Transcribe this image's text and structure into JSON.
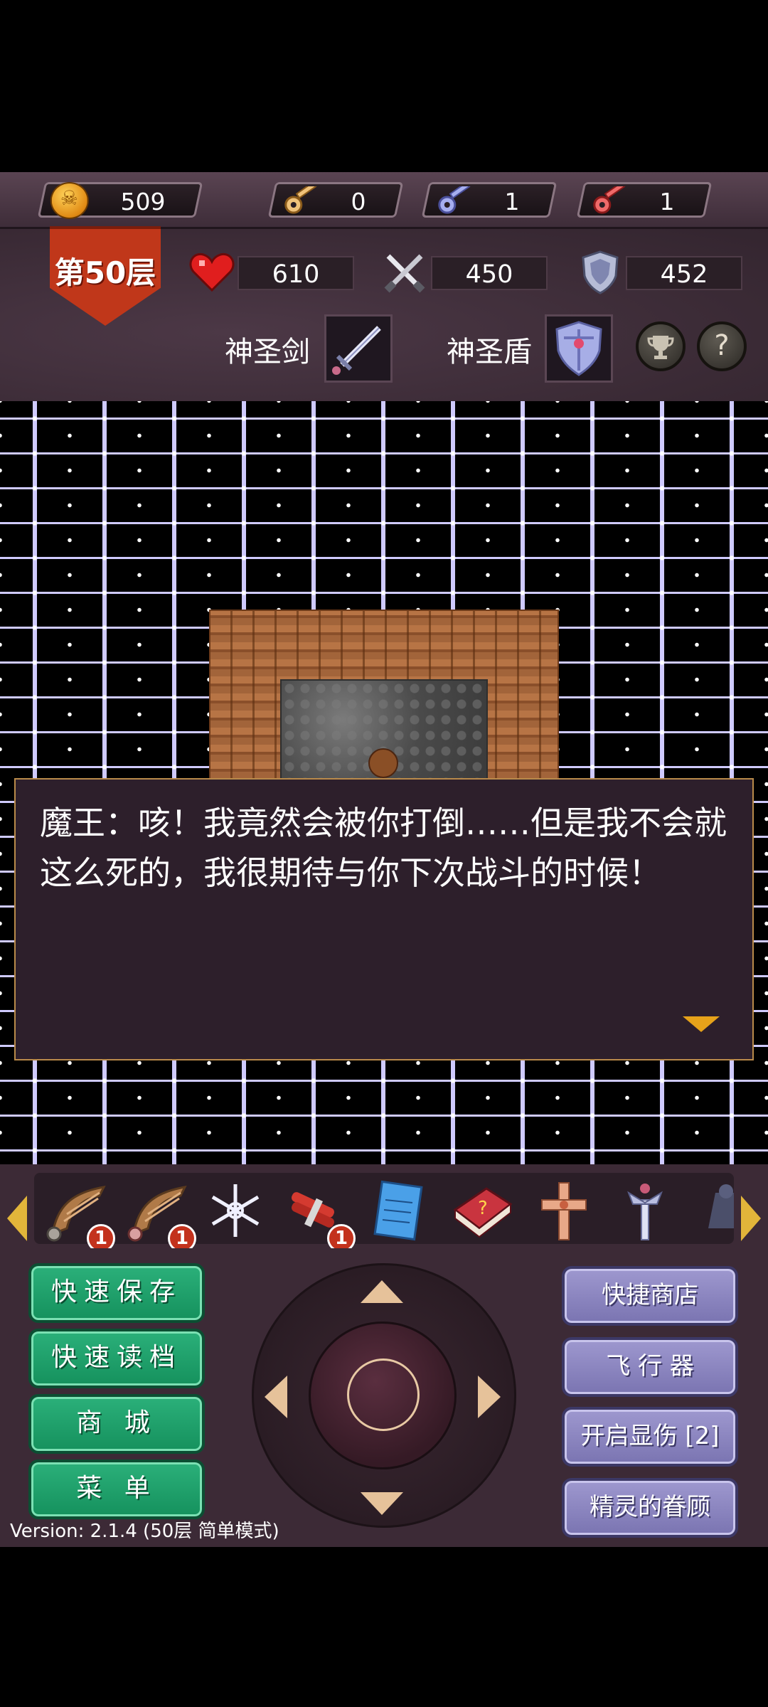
{
  "resources": {
    "gold": "509",
    "yellow_keys": "0",
    "blue_keys": "1",
    "red_keys": "1"
  },
  "floor": {
    "label": "第50层"
  },
  "stats": {
    "hp": "610",
    "attack": "450",
    "defense": "452"
  },
  "equipment": {
    "weapon_label": "神圣剑",
    "shield_label": "神圣盾"
  },
  "buttons_round": {
    "help": "?"
  },
  "dialog": {
    "text": "魔王：咳！我竟然会被你打倒……但是我不会就这么死的，我很期待与你下次战斗的时候！"
  },
  "items": [
    {
      "name": "wing-up",
      "count": "1"
    },
    {
      "name": "wing-down",
      "count": "1"
    },
    {
      "name": "ice-magic",
      "count": ""
    },
    {
      "name": "dynamite",
      "count": "1"
    },
    {
      "name": "notebook",
      "count": ""
    },
    {
      "name": "monster-manual",
      "count": ""
    },
    {
      "name": "cross",
      "count": ""
    },
    {
      "name": "holy-sword-item",
      "count": ""
    },
    {
      "name": "dark-item",
      "count": ""
    }
  ],
  "left_buttons": [
    "快速保存",
    "快速读档",
    "商 城",
    "菜 单"
  ],
  "right_buttons": [
    "快捷商店",
    "飞 行 器",
    "开启显伤 [2]",
    "精灵的眷顾"
  ],
  "version": "Version: 2.1.4 (50层 简单模式)",
  "colors": {
    "floor_banner": "#c0371a",
    "green_button": "#1da56c",
    "purple_button": "#8b86c2",
    "badge": "#c3321d"
  }
}
